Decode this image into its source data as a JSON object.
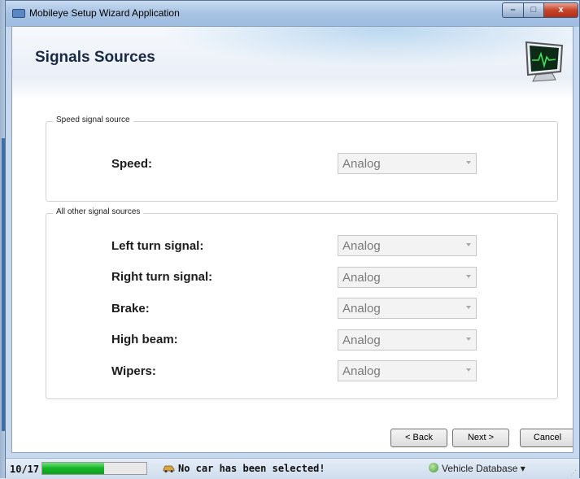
{
  "window": {
    "title": "Mobileye Setup Wizard Application",
    "controls": {
      "minimize": "–",
      "maximize": "□",
      "close": "x"
    }
  },
  "page": {
    "title": "Signals Sources"
  },
  "speed_group": {
    "legend": "Speed signal source",
    "rows": [
      {
        "label": "Speed:",
        "value": "Analog"
      }
    ]
  },
  "other_group": {
    "legend": "All other signal sources",
    "rows": [
      {
        "label": "Left turn signal:",
        "value": "Analog"
      },
      {
        "label": "Right turn signal:",
        "value": "Analog"
      },
      {
        "label": "Brake:",
        "value": "Analog"
      },
      {
        "label": "High beam:",
        "value": "Analog"
      },
      {
        "label": "Wipers:",
        "value": "Analog"
      }
    ]
  },
  "buttons": {
    "back": "< Back",
    "next": "Next >",
    "cancel": "Cancel"
  },
  "status": {
    "page": "10/17",
    "progress_fraction": 0.59,
    "message": "No car has been selected!",
    "database": "Vehicle Database ▾",
    "grip": "⋰"
  },
  "colors": {
    "progress": "#14b425",
    "title_text": "#1a2a44"
  }
}
